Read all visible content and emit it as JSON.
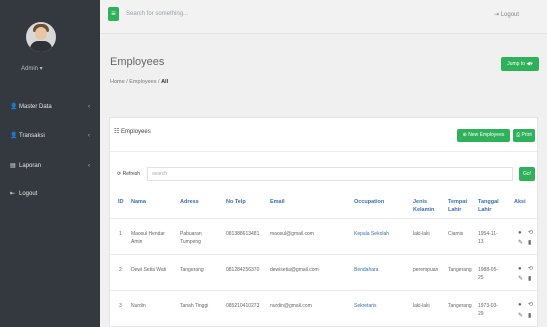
{
  "sidebar": {
    "user_label": "Admin ▾",
    "items": [
      {
        "label": "Master Data",
        "icon": "user-icon",
        "glyph": "👤",
        "chevron": "‹"
      },
      {
        "label": "Transaksi",
        "icon": "user-icon",
        "glyph": "👤",
        "chevron": "‹"
      },
      {
        "label": "Laporan",
        "icon": "book-icon",
        "glyph": "▤",
        "chevron": "‹"
      },
      {
        "label": "Logout",
        "icon": "logout-icon",
        "glyph": "⇤",
        "chevron": ""
      }
    ]
  },
  "topbar": {
    "menu_glyph": "≡",
    "search_placeholder": "Search for something...",
    "logout_label": "⇥  Logout"
  },
  "page": {
    "title": "Employees",
    "breadcrumb": [
      "Home",
      "Employees",
      "All"
    ],
    "jump_label": "Jump to ◀▾"
  },
  "card": {
    "title": "☷ Employees",
    "new_label": "⊕ New Employees",
    "print_label": "⎙ Print",
    "refresh_label": "⟳ Refresh",
    "search_placeholder": "search",
    "go_label": "Go!"
  },
  "table": {
    "headers": [
      "ID",
      "Nama",
      "Adress",
      "No Telp",
      "Email",
      "Occupation",
      "Jenis Kelamin",
      "Tempat Lahir",
      "Tanggal Lahir",
      "Aksi"
    ],
    "rows": [
      {
        "id": "1",
        "nama": "Maosul Hendar Amin",
        "adress": "Pabuaran Tumpeng",
        "telp": "081388613481",
        "email": "maosul@gmail.com",
        "occupation": "Kepala Sekolah",
        "jenis": "laki-laki",
        "tempat": "Ciamis",
        "tanggal": "1954-11-13"
      },
      {
        "id": "2",
        "nama": "Dewi Setia Wati",
        "adress": "Tangerang",
        "telp": "081284256370",
        "email": "dewisetia@gmail.com",
        "occupation": "Bendahara",
        "jenis": "perempuan",
        "tempat": "Tangerang",
        "tanggal": "1988-05-25"
      },
      {
        "id": "3",
        "nama": "Nurdin",
        "adress": "Tanah Tinggi",
        "telp": "085210410273",
        "email": "nurdin@gmail.com",
        "occupation": "Sekretaris",
        "jenis": "laki-laki",
        "tempat": "Tangerang",
        "tanggal": "1973-03-29"
      }
    ],
    "action_glyphs": {
      "view": "●",
      "history": "⟲",
      "edit": "✎",
      "delete": "▮"
    }
  },
  "colors": {
    "accent": "#2fb15a",
    "sidebar": "#34393f",
    "link": "#3a6fb0"
  }
}
